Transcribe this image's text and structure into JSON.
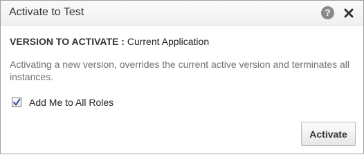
{
  "dialog": {
    "title": "Activate to Test",
    "help_icon": "help-icon",
    "close_icon": "close-icon"
  },
  "version": {
    "label": "VERSION TO ACTIVATE :",
    "value": "Current Application"
  },
  "description": "Activating a new version, overrides the current active version and terminates all instances.",
  "checkbox": {
    "label": "Add Me to All Roles",
    "checked": true
  },
  "buttons": {
    "activate_label": "Activate"
  }
}
